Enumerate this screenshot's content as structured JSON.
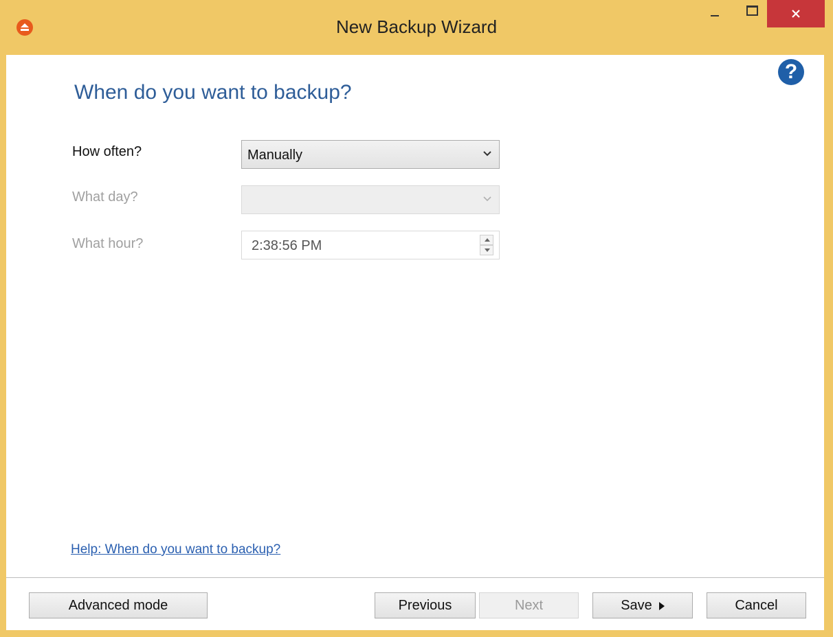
{
  "window": {
    "title": "New Backup Wizard",
    "accent_color": "#f0c866",
    "close_color": "#c7363a"
  },
  "icons": {
    "app": "app-logo-icon",
    "help": "help-question-icon",
    "help_glyph": "?",
    "minimize": "minimize-icon",
    "maximize": "maximize-icon",
    "close": "close-icon"
  },
  "page": {
    "title": "When do you want to backup?"
  },
  "form": {
    "how_often_label": "How often?",
    "how_often_value": "Manually",
    "what_day_label": "What day?",
    "what_day_value": "",
    "what_hour_label": "What hour?",
    "what_hour_value": "2:38:56 PM"
  },
  "help_link": "Help: When do you want to backup?",
  "buttons": {
    "advanced": "Advanced mode",
    "previous": "Previous",
    "next": "Next",
    "save": "Save",
    "cancel": "Cancel"
  }
}
